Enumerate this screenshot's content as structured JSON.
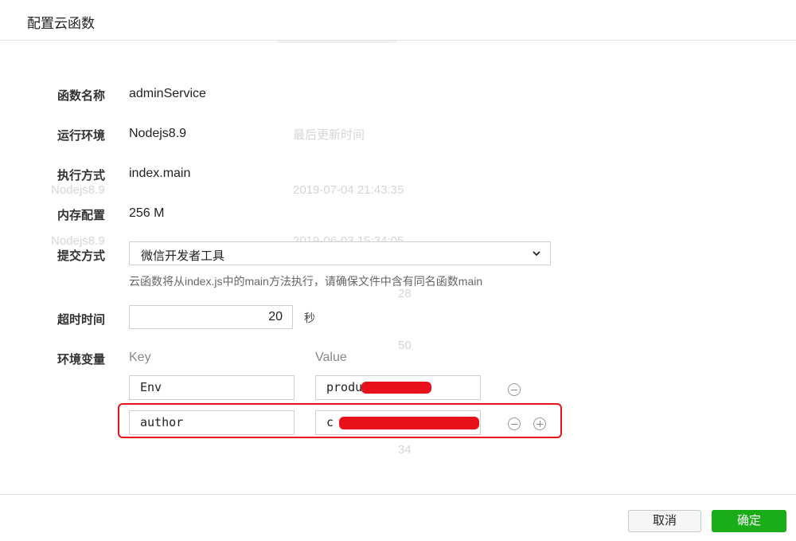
{
  "dialog": {
    "title": "配置云函数"
  },
  "background_ghost": {
    "column_header": "最后更新时间",
    "row1_env": "Nodejs8.9",
    "row1_time": "2019-07-04 21:43:35",
    "row2_env": "Nodejs8.9",
    "row2_time": "2019-06-03 15:34:05",
    "num1": "28",
    "num2": "50",
    "num3": "34"
  },
  "form": {
    "function_name": {
      "label": "函数名称",
      "value": "adminService"
    },
    "runtime": {
      "label": "运行环境",
      "value": "Nodejs8.9"
    },
    "handler": {
      "label": "执行方式",
      "value": "index.main"
    },
    "memory": {
      "label": "内存配置",
      "value": "256 M"
    },
    "submit_method": {
      "label": "提交方式",
      "selected": "微信开发者工具",
      "hint": "云函数将从index.js中的main方法执行，请确保文件中含有同名函数main"
    },
    "timeout": {
      "label": "超时时间",
      "value": "20",
      "unit": "秒"
    },
    "env_vars": {
      "label": "环境变量",
      "key_header": "Key",
      "value_header": "Value",
      "rows": [
        {
          "key": "Env",
          "value": "produ"
        },
        {
          "key": "author",
          "value": "c"
        }
      ]
    }
  },
  "footer": {
    "cancel_label": "取消",
    "confirm_label": "确定"
  },
  "colors": {
    "primary": "#1aad19",
    "redaction": "#e8101a",
    "highlight_border": "#e8101a"
  }
}
